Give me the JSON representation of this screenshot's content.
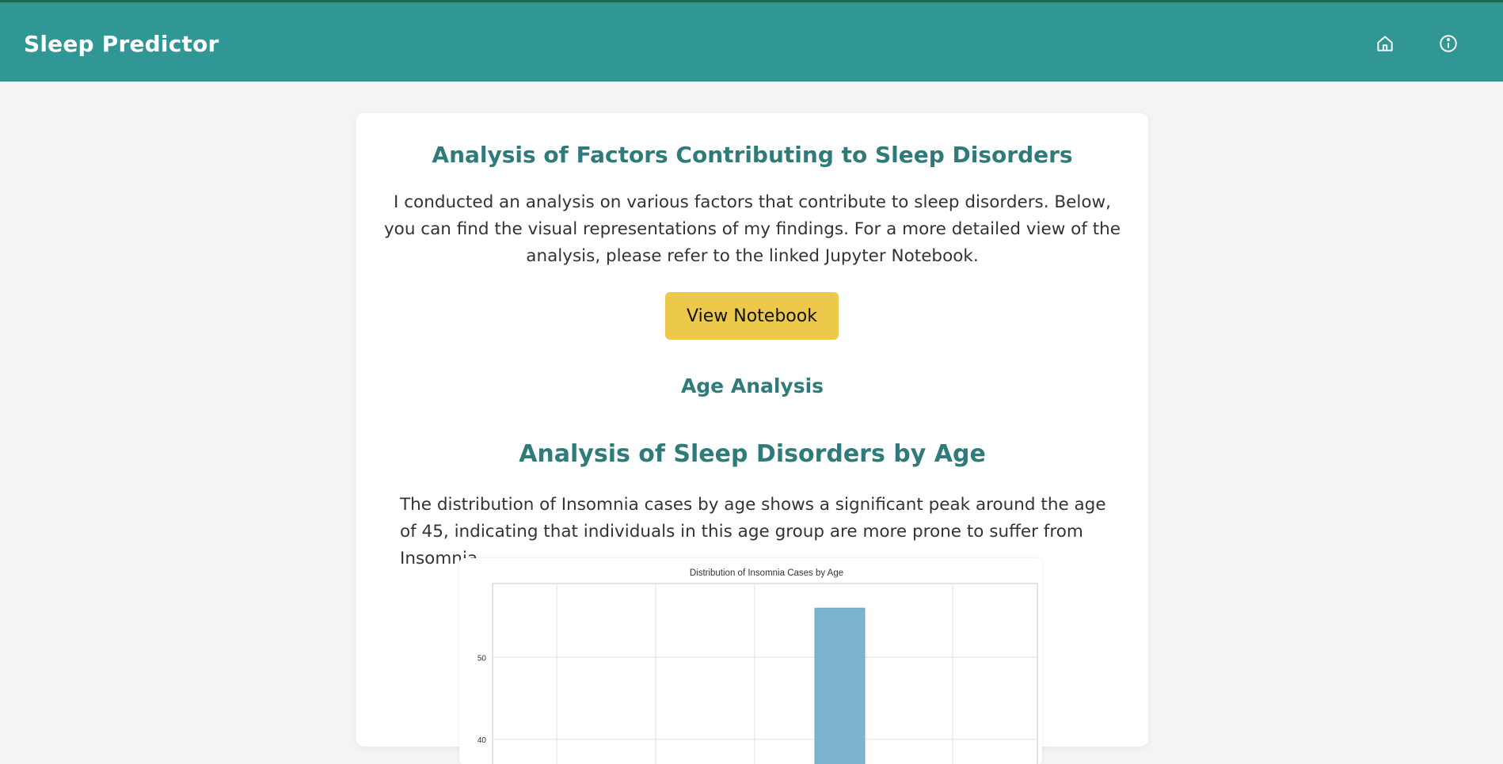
{
  "app": {
    "title": "Sleep Predictor"
  },
  "nav": [
    {
      "icon": "home-icon"
    },
    {
      "icon": "info-icon"
    }
  ],
  "colors": {
    "header": "#319795",
    "accent_text": "#2f7b7a",
    "button": "#ecc94b",
    "bar": "#7cb3cf"
  },
  "page": {
    "title": "Analysis of Factors Contributing to Sleep Disorders",
    "intro": "I conducted an analysis on various factors that contribute to sleep disorders. Below, you can find the visual representations of my findings. For a more detailed view of the analysis, please refer to the linked Jupyter Notebook.",
    "button_label": "View Notebook",
    "section_heading": "Age Analysis",
    "subsection_title": "Analysis of Sleep Disorders by Age",
    "subsection_text": "The distribution of Insomnia cases by age shows a significant peak around the age of 45, indicating that individuals in this age group are more prone to suffer from Insomnia."
  },
  "chart_data": {
    "type": "bar",
    "title": "Distribution of Insomnia Cases by Age",
    "y_ticks": [
      40,
      50
    ],
    "bars": [
      {
        "value": 56
      }
    ],
    "ylim_visible": [
      37,
      59
    ],
    "grid": true
  }
}
